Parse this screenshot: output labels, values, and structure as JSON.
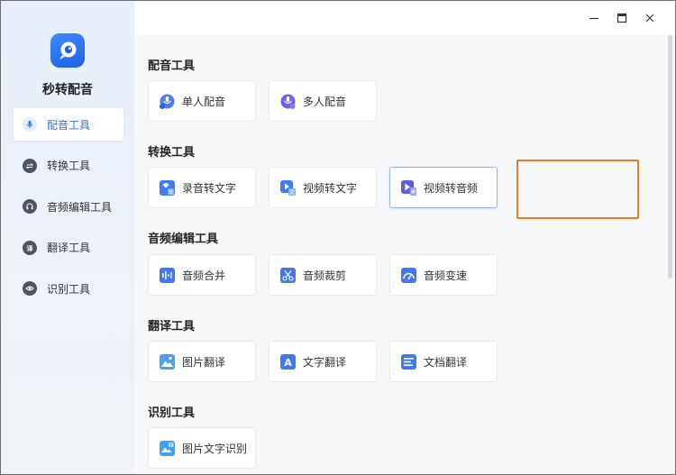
{
  "app": {
    "name": "秒转配音",
    "colors": {
      "accent": "#2f6fea",
      "highlight": "#f07f1d"
    }
  },
  "window_controls": {
    "minimize_icon": "minimize-icon",
    "maximize_icon": "maximize-icon",
    "close_icon": "close-icon"
  },
  "sidebar": {
    "items": [
      {
        "label": "配音工具",
        "icon": "microphone-icon",
        "active": true
      },
      {
        "label": "转换工具",
        "icon": "convert-arrows-icon",
        "active": false
      },
      {
        "label": "音频编辑工具",
        "icon": "headphones-icon",
        "active": false
      },
      {
        "label": "翻译工具",
        "icon": "translate-icon",
        "active": false
      },
      {
        "label": "识别工具",
        "icon": "eye-icon",
        "active": false
      }
    ]
  },
  "sections": [
    {
      "title": "配音工具",
      "cards": [
        {
          "label": "单人配音",
          "icon": "single-voice-icon"
        },
        {
          "label": "多人配音",
          "icon": "multi-voice-icon"
        }
      ]
    },
    {
      "title": "转换工具",
      "cards": [
        {
          "label": "录音转文字",
          "icon": "record-to-text-icon"
        },
        {
          "label": "视频转文字",
          "icon": "video-to-text-icon"
        },
        {
          "label": "视频转音频",
          "icon": "video-to-audio-icon",
          "selected": true
        }
      ]
    },
    {
      "title": "音频编辑工具",
      "cards": [
        {
          "label": "音频合并",
          "icon": "audio-merge-icon"
        },
        {
          "label": "音频裁剪",
          "icon": "audio-cut-icon"
        },
        {
          "label": "音频变速",
          "icon": "audio-speed-icon"
        }
      ]
    },
    {
      "title": "翻译工具",
      "cards": [
        {
          "label": "图片翻译",
          "icon": "image-translate-icon"
        },
        {
          "label": "文字翻译",
          "icon": "text-translate-icon"
        },
        {
          "label": "文档翻译",
          "icon": "document-translate-icon"
        }
      ]
    },
    {
      "title": "识别工具",
      "cards": [
        {
          "label": "图片文字识别",
          "icon": "image-ocr-icon"
        }
      ]
    }
  ]
}
